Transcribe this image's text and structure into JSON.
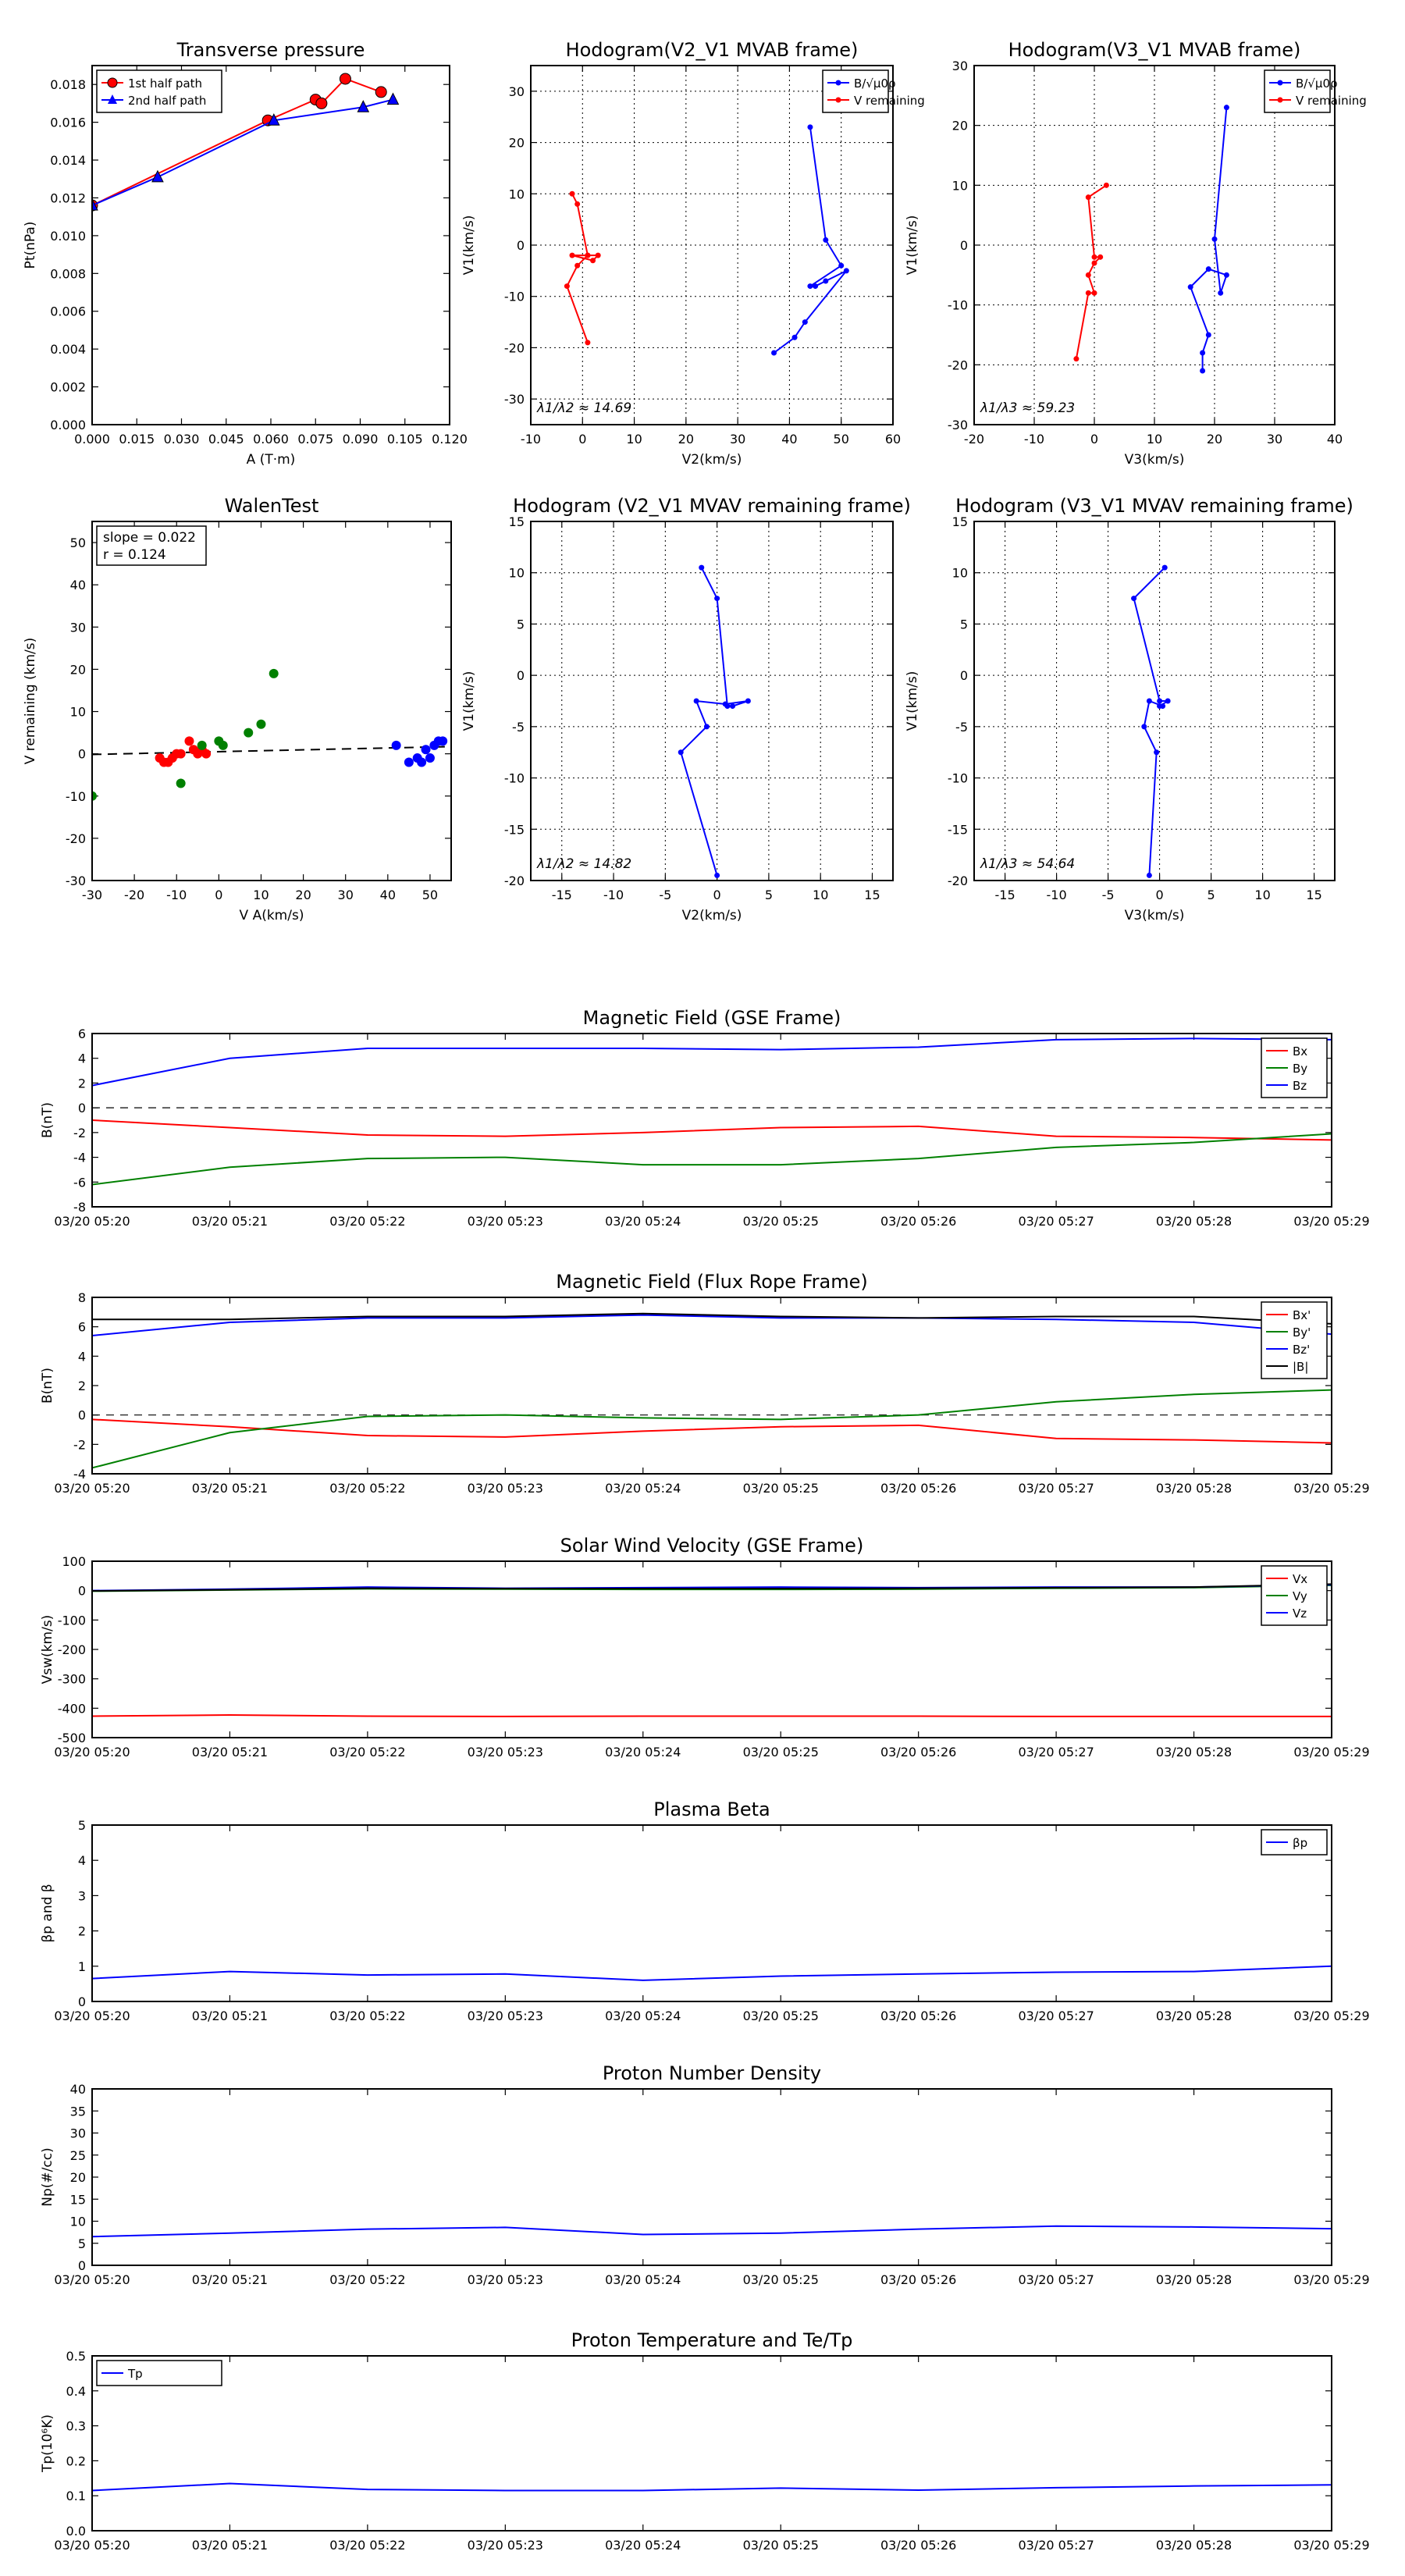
{
  "colors": {
    "red": "#ff0000",
    "green": "#008000",
    "blue": "#0000ff",
    "black": "#000000",
    "grid": "#000000"
  },
  "time_ticks": [
    "03/20 05:20",
    "03/20 05:21",
    "03/20 05:22",
    "03/20 05:23",
    "03/20 05:24",
    "03/20 05:25",
    "03/20 05:26",
    "03/20 05:27",
    "03/20 05:28",
    "03/20 05:29"
  ],
  "chart_data": [
    {
      "id": "tp",
      "type": "line",
      "title": "Transverse pressure",
      "xlabel": "A (T·m)",
      "ylabel": "Pt(nPa)",
      "xlim": [
        0,
        0.12
      ],
      "ylim": [
        0,
        0.019
      ],
      "xticks": [
        0,
        0.015,
        0.03,
        0.045,
        0.06,
        0.075,
        0.09,
        0.105,
        0.12
      ],
      "xticklabels": [
        "0.000",
        "0.015",
        "0.030",
        "0.045",
        "0.060",
        "0.075",
        "0.090",
        "0.105",
        "0.120"
      ],
      "yticks": [
        0,
        0.002,
        0.004,
        0.006,
        0.008,
        0.01,
        0.012,
        0.014,
        0.016,
        0.018
      ],
      "yticklabels": [
        "0.000",
        "0.002",
        "0.004",
        "0.006",
        "0.008",
        "0.010",
        "0.012",
        "0.014",
        "0.016",
        "0.018"
      ],
      "grid": false,
      "legend": "top-left",
      "series": [
        {
          "name": "1st half path",
          "color": "red",
          "marker": "circle",
          "x": [
            0.0,
            0.059,
            0.075,
            0.077,
            0.085,
            0.097
          ],
          "y": [
            0.0116,
            0.0161,
            0.0172,
            0.017,
            0.0183,
            0.0176
          ]
        },
        {
          "name": "2nd half path",
          "color": "blue",
          "marker": "triangle",
          "x": [
            0.0,
            0.022,
            0.061,
            0.091,
            0.101
          ],
          "y": [
            0.0116,
            0.0131,
            0.0161,
            0.0168,
            0.0172
          ]
        }
      ]
    },
    {
      "id": "hodo1",
      "type": "line",
      "title": "Hodogram(V2_V1 MVAB frame)",
      "xlabel": "V2(km/s)",
      "ylabel": "V1(km/s)",
      "xlim": [
        -10,
        60
      ],
      "ylim": [
        -35,
        35
      ],
      "xticks": [
        -10,
        0,
        10,
        20,
        30,
        40,
        50,
        60
      ],
      "yticks": [
        -30,
        -20,
        -10,
        0,
        10,
        20,
        30
      ],
      "grid": true,
      "legend": "top-right",
      "annotation": "λ1/λ2 ≈ 14.69",
      "series": [
        {
          "name": "B/√μ0ρ",
          "color": "blue",
          "marker": "dot",
          "x": [
            44,
            47,
            50,
            44,
            45,
            47,
            51,
            43,
            41,
            37
          ],
          "y": [
            23,
            1,
            -4,
            -8,
            -8,
            -7,
            -5,
            -15,
            -18,
            -21
          ]
        },
        {
          "name": "V remaining",
          "color": "red",
          "marker": "dot",
          "x": [
            -2,
            -1,
            1,
            3,
            2,
            -2,
            1,
            -1,
            -3,
            1
          ],
          "y": [
            10,
            8,
            -2,
            -2,
            -3,
            -2,
            -2,
            -4,
            -8,
            -19
          ]
        }
      ]
    },
    {
      "id": "hodo2",
      "type": "line",
      "title": "Hodogram(V3_V1 MVAB frame)",
      "xlabel": "V3(km/s)",
      "ylabel": "V1(km/s)",
      "xlim": [
        -20,
        40
      ],
      "ylim": [
        -30,
        30
      ],
      "xticks": [
        -20,
        -10,
        0,
        10,
        20,
        30,
        40
      ],
      "yticks": [
        -30,
        -20,
        -10,
        0,
        10,
        20,
        30
      ],
      "grid": true,
      "legend": "top-right",
      "annotation": "λ1/λ3 ≈ 59.23",
      "series": [
        {
          "name": "B/√μ0ρ",
          "color": "blue",
          "marker": "dot",
          "x": [
            22,
            20,
            21,
            22,
            19,
            16,
            19,
            18,
            18
          ],
          "y": [
            23,
            1,
            -8,
            -5,
            -4,
            -7,
            -15,
            -18,
            -21
          ]
        },
        {
          "name": "V remaining",
          "color": "red",
          "marker": "dot",
          "x": [
            2,
            -1,
            0,
            1,
            0,
            -1,
            0,
            -1,
            -3
          ],
          "y": [
            10,
            8,
            -2,
            -2,
            -3,
            -5,
            -8,
            -8,
            -19
          ]
        }
      ]
    },
    {
      "id": "walen",
      "type": "scatter",
      "title": "WalenTest",
      "xlabel": "V A(km/s)",
      "ylabel": "V remaining (km/s)",
      "xlim": [
        -30,
        55
      ],
      "ylim": [
        -30,
        55
      ],
      "xticks": [
        -30,
        -20,
        -10,
        0,
        10,
        20,
        30,
        40,
        50
      ],
      "yticks": [
        -30,
        -20,
        -10,
        0,
        10,
        20,
        30,
        40,
        50
      ],
      "grid": false,
      "legend": "top-left",
      "legend_lines": [
        "slope = 0.022",
        "r = 0.124"
      ],
      "fit": {
        "slope": 0.022,
        "intercept": 0.5,
        "style": "dashed"
      },
      "series": [
        {
          "name": "",
          "color": "red",
          "x": [
            -14,
            -13,
            -12,
            -11,
            -10,
            -9,
            -7,
            -6,
            -5,
            -4,
            -3
          ],
          "y": [
            -1,
            -2,
            -2,
            -1,
            0,
            0,
            3,
            1,
            0,
            1,
            0
          ]
        },
        {
          "name": "",
          "color": "green",
          "x": [
            -30,
            -9,
            -4,
            0,
            1,
            7,
            10,
            13
          ],
          "y": [
            -10,
            -7,
            2,
            3,
            2,
            5,
            7,
            19
          ]
        },
        {
          "name": "",
          "color": "blue",
          "x": [
            42,
            45,
            47,
            48,
            49,
            50,
            51,
            52,
            53
          ],
          "y": [
            2,
            -2,
            -1,
            -2,
            1,
            -1,
            2,
            3,
            3
          ]
        }
      ]
    },
    {
      "id": "hodo3",
      "type": "line",
      "title": "Hodogram (V2_V1 MVAV remaining frame)",
      "xlabel": "V2(km/s)",
      "ylabel": "V1(km/s)",
      "xlim": [
        -18,
        17
      ],
      "ylim": [
        -20,
        15
      ],
      "xticks": [
        -15,
        -10,
        -5,
        0,
        5,
        10,
        15
      ],
      "yticks": [
        -20,
        -15,
        -10,
        -5,
        0,
        5,
        10,
        15
      ],
      "grid": true,
      "annotation": "λ1/λ2 ≈ 14.82",
      "series": [
        {
          "name": "",
          "color": "blue",
          "marker": "dot",
          "x": [
            -1.5,
            0,
            1,
            1.5,
            3,
            0.8,
            -2,
            -1,
            -3.5,
            0
          ],
          "y": [
            10.5,
            7.5,
            -3,
            -3,
            -2.5,
            -2.8,
            -2.5,
            -5,
            -7.5,
            -19.5
          ]
        }
      ]
    },
    {
      "id": "hodo4",
      "type": "line",
      "title": "Hodogram (V3_V1 MVAV remaining frame)",
      "xlabel": "V3(km/s)",
      "ylabel": "V1(km/s)",
      "xlim": [
        -18,
        17
      ],
      "ylim": [
        -20,
        15
      ],
      "xticks": [
        -15,
        -10,
        -5,
        0,
        5,
        10,
        15
      ],
      "yticks": [
        -20,
        -15,
        -10,
        -5,
        0,
        5,
        10,
        15
      ],
      "grid": true,
      "annotation": "λ1/λ3 ≈ 54.64",
      "series": [
        {
          "name": "",
          "color": "blue",
          "marker": "dot",
          "x": [
            0.5,
            -2.5,
            0,
            0.8,
            0,
            0.3,
            -1,
            -1.5,
            -0.3,
            -1
          ],
          "y": [
            10.5,
            7.5,
            -2.5,
            -2.5,
            -3,
            -3,
            -2.5,
            -5,
            -7.5,
            -19.5
          ]
        }
      ]
    },
    {
      "id": "bgse",
      "type": "line",
      "title": "Magnetic Field (GSE Frame)",
      "xlabel": "",
      "ylabel": "B(nT)",
      "xlim": [
        0,
        9
      ],
      "ylim": [
        -8,
        6
      ],
      "yticks": [
        -8,
        -6,
        -4,
        -2,
        0,
        2,
        4,
        6
      ],
      "grid": false,
      "legend": "top-right",
      "zero_line": true,
      "series": [
        {
          "name": "Bx",
          "color": "red",
          "y": [
            -1.0,
            -1.6,
            -2.2,
            -2.3,
            -2.0,
            -1.6,
            -1.5,
            -2.3,
            -2.4,
            -2.6
          ]
        },
        {
          "name": "By",
          "color": "green",
          "y": [
            -6.2,
            -4.8,
            -4.1,
            -4.0,
            -4.6,
            -4.6,
            -4.1,
            -3.2,
            -2.8,
            -2.1
          ]
        },
        {
          "name": "Bz",
          "color": "blue",
          "y": [
            1.8,
            4.0,
            4.8,
            4.8,
            4.8,
            4.7,
            4.9,
            5.5,
            5.6,
            5.5
          ]
        }
      ]
    },
    {
      "id": "bfr",
      "type": "line",
      "title": "Magnetic Field (Flux Rope Frame)",
      "xlabel": "",
      "ylabel": "B(nT)",
      "xlim": [
        0,
        9
      ],
      "ylim": [
        -4,
        8
      ],
      "yticks": [
        -4,
        -2,
        0,
        2,
        4,
        6,
        8
      ],
      "grid": false,
      "legend": "top-right",
      "zero_line": true,
      "series": [
        {
          "name": "Bx'",
          "color": "red",
          "y": [
            -0.3,
            -0.8,
            -1.4,
            -1.5,
            -1.1,
            -0.8,
            -0.7,
            -1.6,
            -1.7,
            -1.9
          ]
        },
        {
          "name": "By'",
          "color": "green",
          "y": [
            -3.6,
            -1.2,
            -0.1,
            0.0,
            -0.2,
            -0.3,
            0.0,
            0.9,
            1.4,
            1.7
          ]
        },
        {
          "name": "Bz'",
          "color": "blue",
          "y": [
            5.4,
            6.3,
            6.6,
            6.6,
            6.8,
            6.6,
            6.6,
            6.5,
            6.3,
            5.5
          ]
        },
        {
          "name": "|B|",
          "color": "black",
          "y": [
            6.5,
            6.5,
            6.7,
            6.7,
            6.9,
            6.7,
            6.6,
            6.7,
            6.7,
            6.2
          ]
        }
      ]
    },
    {
      "id": "vsw",
      "type": "line",
      "title": "Solar Wind Velocity (GSE Frame)",
      "xlabel": "",
      "ylabel": "Vsw(km/s)",
      "xlim": [
        0,
        9
      ],
      "ylim": [
        -500,
        100
      ],
      "yticks": [
        -500,
        -400,
        -300,
        -200,
        -100,
        0,
        100
      ],
      "grid": false,
      "legend": "top-right",
      "series": [
        {
          "name": "Vx",
          "color": "red",
          "y": [
            -427,
            -423,
            -427,
            -428,
            -427,
            -427,
            -427,
            -428,
            -428,
            -428
          ]
        },
        {
          "name": "Vy",
          "color": "green",
          "y": [
            -2,
            2,
            6,
            5,
            4,
            4,
            5,
            8,
            10,
            18
          ]
        },
        {
          "name": "Vz",
          "color": "blue",
          "y": [
            0,
            5,
            12,
            8,
            10,
            12,
            10,
            12,
            12,
            20
          ]
        },
        {
          "name": "",
          "color": "black",
          "y": [
            -1,
            3,
            8,
            7,
            7,
            7,
            8,
            10,
            12,
            22
          ]
        }
      ]
    },
    {
      "id": "beta",
      "type": "line",
      "title": "Plasma Beta",
      "xlabel": "",
      "ylabel": "βp and β",
      "xlim": [
        0,
        9
      ],
      "ylim": [
        0,
        5
      ],
      "yticks": [
        0,
        1,
        2,
        3,
        4,
        5
      ],
      "grid": false,
      "legend": "top-right",
      "series": [
        {
          "name": "βp",
          "color": "blue",
          "y": [
            0.65,
            0.85,
            0.75,
            0.78,
            0.6,
            0.72,
            0.78,
            0.83,
            0.85,
            1.0
          ]
        }
      ]
    },
    {
      "id": "np",
      "type": "line",
      "title": "Proton Number Density",
      "xlabel": "",
      "ylabel": "Np(#/cc)",
      "xlim": [
        0,
        9
      ],
      "ylim": [
        0,
        40
      ],
      "yticks": [
        0,
        5,
        10,
        15,
        20,
        25,
        30,
        35,
        40
      ],
      "grid": false,
      "series": [
        {
          "name": "",
          "color": "blue",
          "y": [
            6.5,
            7.3,
            8.2,
            8.6,
            7.0,
            7.3,
            8.2,
            8.9,
            8.7,
            8.3
          ]
        }
      ]
    },
    {
      "id": "tpp",
      "type": "line",
      "title": "Proton Temperature and Te/Tp",
      "xlabel": "",
      "ylabel": "Tp(10⁶K)",
      "xlim": [
        0,
        9
      ],
      "ylim": [
        0,
        0.5
      ],
      "yticks": [
        0,
        0.1,
        0.2,
        0.3,
        0.4,
        0.5
      ],
      "yticklabels": [
        "0.0",
        "0.1",
        "0.2",
        "0.3",
        "0.4",
        "0.5"
      ],
      "grid": false,
      "legend": "top-left",
      "series": [
        {
          "name": "Tp",
          "color": "blue",
          "y": [
            0.115,
            0.135,
            0.118,
            0.115,
            0.115,
            0.122,
            0.116,
            0.123,
            0.128,
            0.131
          ]
        }
      ]
    }
  ]
}
